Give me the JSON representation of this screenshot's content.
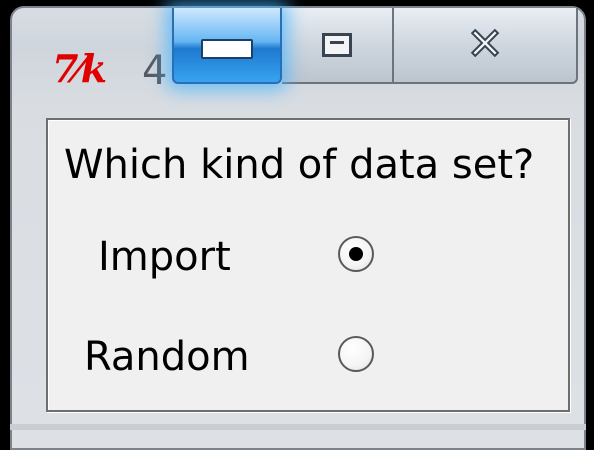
{
  "window": {
    "app_icon_text": "7⁄k",
    "title_fragment": "4",
    "caption": {
      "minimize": "minimize",
      "maximize": "maximize",
      "close": "close"
    }
  },
  "dialog": {
    "question": "Which kind of data set?",
    "options": [
      {
        "label": "Import",
        "selected": true
      },
      {
        "label": "Random",
        "selected": false
      }
    ]
  },
  "colors": {
    "app_icon": "#e00000",
    "minimize_hover_glow": "#46b4ff",
    "background": "#f0f0f0"
  }
}
